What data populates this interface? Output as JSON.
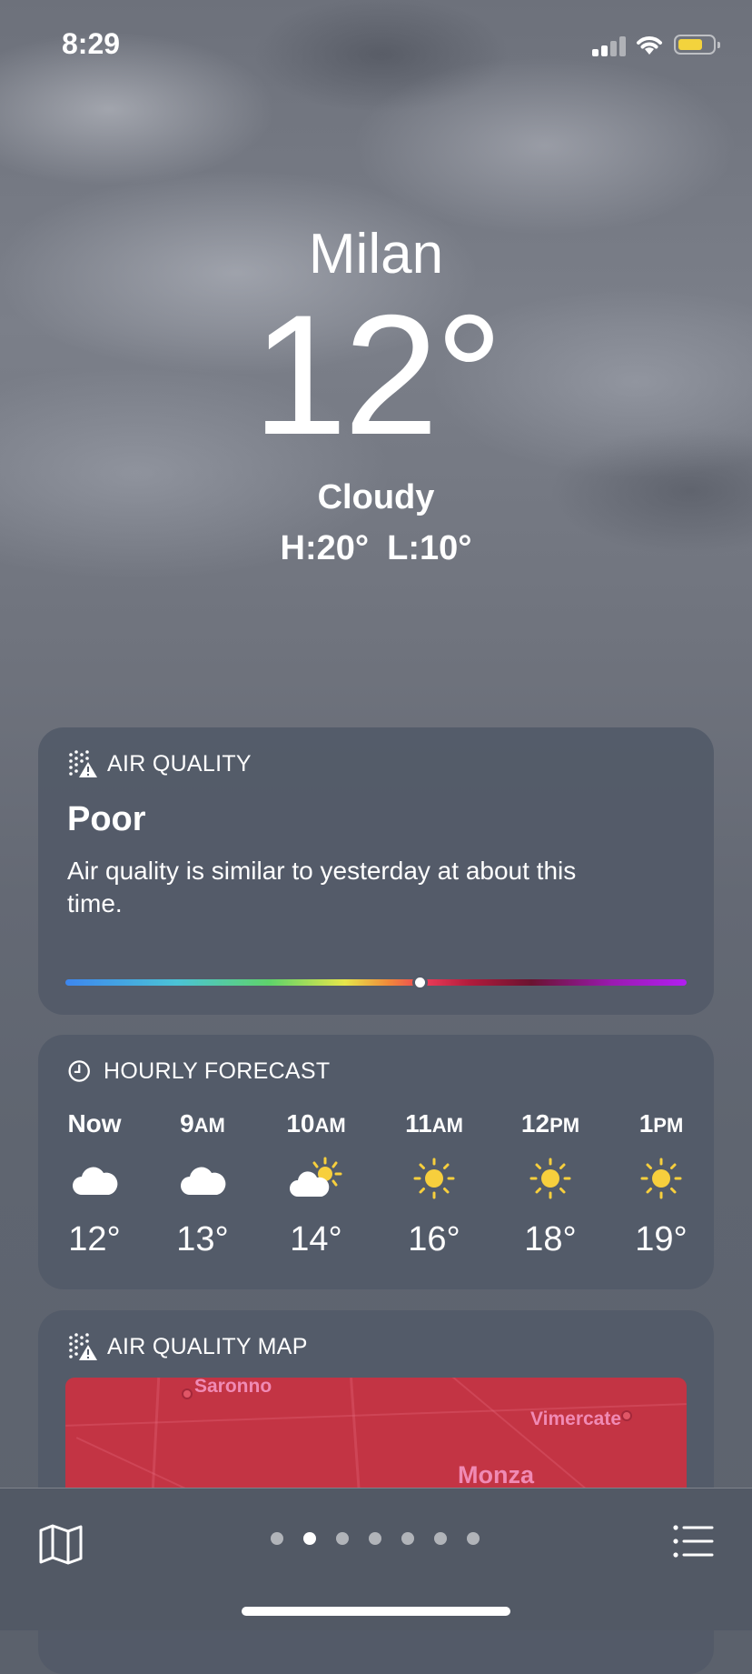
{
  "status_bar": {
    "time": "8:29"
  },
  "location": {
    "city": "Milan",
    "temperature": "12°",
    "condition": "Cloudy",
    "high": "H:20°",
    "low": "L:10°"
  },
  "air_quality": {
    "header": "AIR QUALITY",
    "level": "Poor",
    "description": "Air quality is similar to yesterday at about this time.",
    "scale_position": 0.57
  },
  "hourly_forecast": {
    "header": "HOURLY FORECAST",
    "hours": [
      {
        "time": "Now",
        "suffix": "",
        "icon": "cloud-icon",
        "temp": "12°"
      },
      {
        "time": "9",
        "suffix": "AM",
        "icon": "cloud-icon",
        "temp": "13°"
      },
      {
        "time": "10",
        "suffix": "AM",
        "icon": "partly-cloudy-icon",
        "temp": "14°"
      },
      {
        "time": "11",
        "suffix": "AM",
        "icon": "sun-icon",
        "temp": "16°"
      },
      {
        "time": "12",
        "suffix": "PM",
        "icon": "sun-icon",
        "temp": "18°"
      },
      {
        "time": "1",
        "suffix": "PM",
        "icon": "sun-icon",
        "temp": "19°"
      }
    ]
  },
  "air_quality_map": {
    "header": "AIR QUALITY MAP",
    "places": [
      "Saronno",
      "Vimercate",
      "Monza"
    ]
  },
  "tab_bar": {
    "page_count": 7,
    "active_page": 2
  },
  "colors": {
    "card": "#525a68",
    "map_red": "#c33444",
    "sun_yellow": "#f7cf3d",
    "battery": "#f3d33d"
  }
}
